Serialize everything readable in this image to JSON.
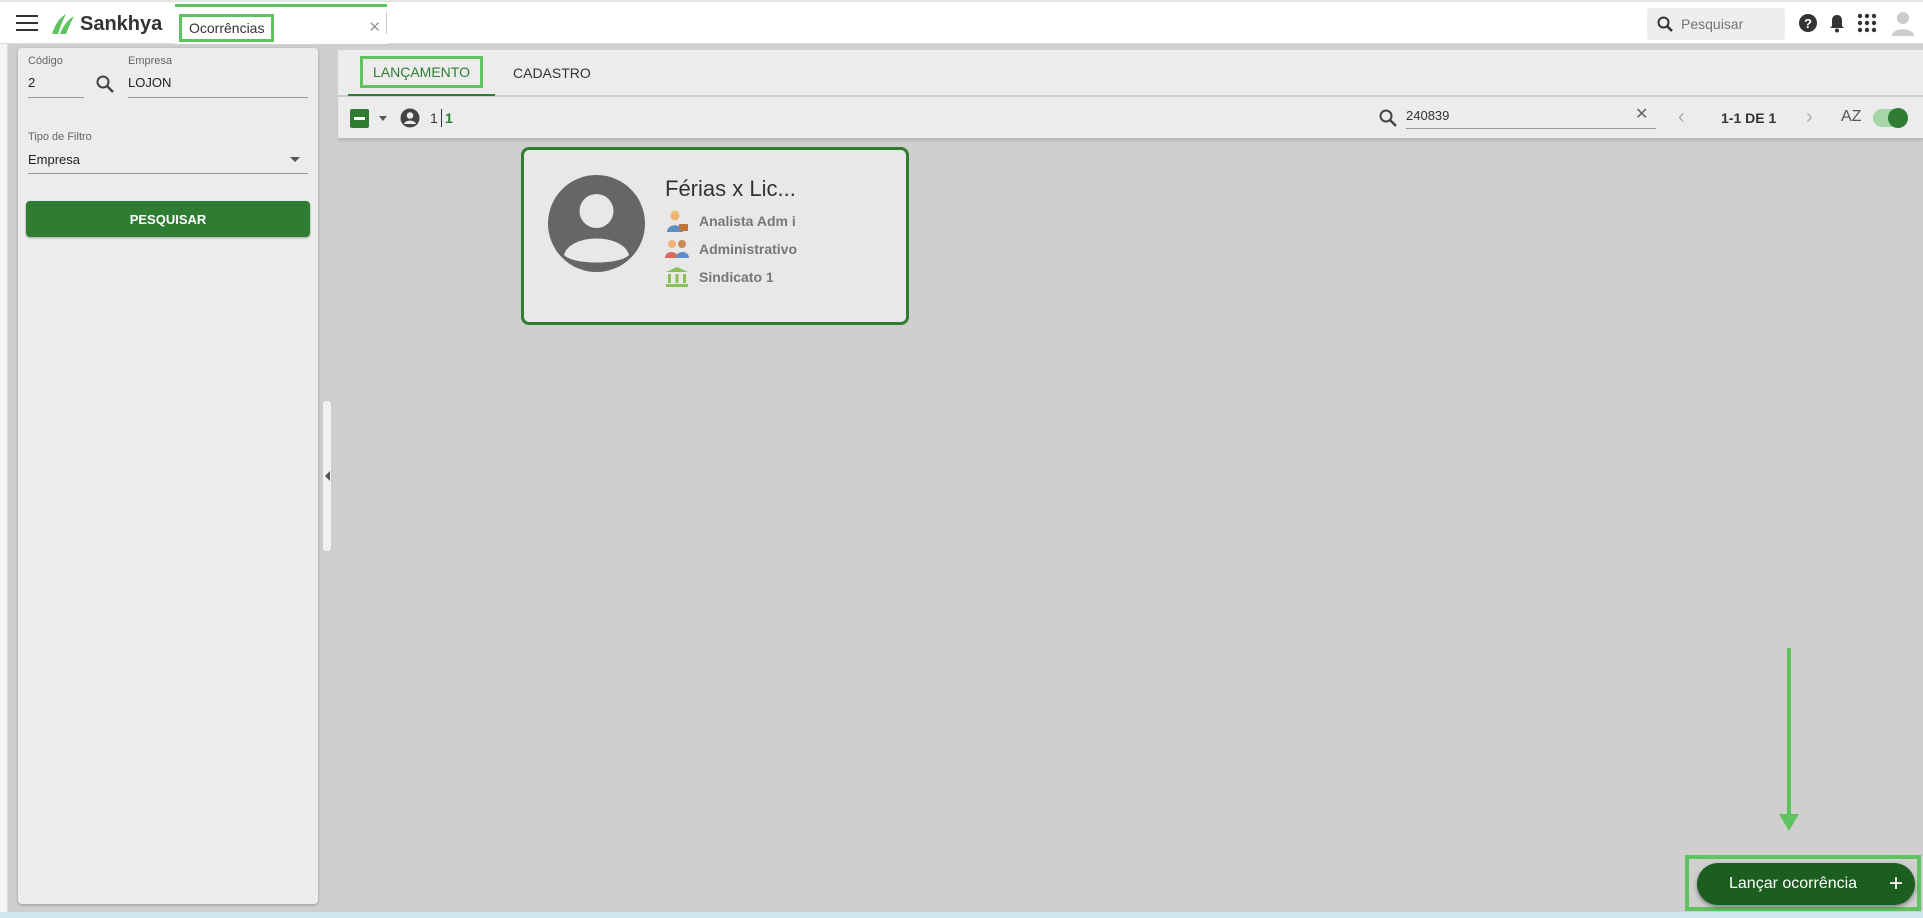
{
  "topbar": {
    "brand": "Sankhya",
    "open_tab": "Ocorrências",
    "search_placeholder": "Pesquisar",
    "brand_color": "#5fc35f"
  },
  "filters": {
    "codigo_label": "Código",
    "codigo_value": "2",
    "empresa_label": "Empresa",
    "empresa_value": "LOJON",
    "tipo_filtro_label": "Tipo de Filtro",
    "tipo_filtro_value": "Empresa",
    "search_button": "PESQUISAR"
  },
  "main": {
    "tabs": [
      {
        "label": "LANÇAMENTO",
        "active": true
      },
      {
        "label": "CADASTRO",
        "active": false
      }
    ],
    "toolbar": {
      "selected_count": "1",
      "total_count": "1",
      "filter_value": "240839",
      "pager": "1-1 DE 1",
      "sort_label": "AZ"
    },
    "card": {
      "title": "Férias x Lic...",
      "role": "Analista Adm i",
      "department": "Administrativo",
      "union": "Sindicato 1"
    },
    "fab_label": "Lançar ocorrência"
  },
  "colors": {
    "primary": "#2e7d32",
    "highlight": "#5fc35f",
    "fab": "#1b5e20"
  }
}
